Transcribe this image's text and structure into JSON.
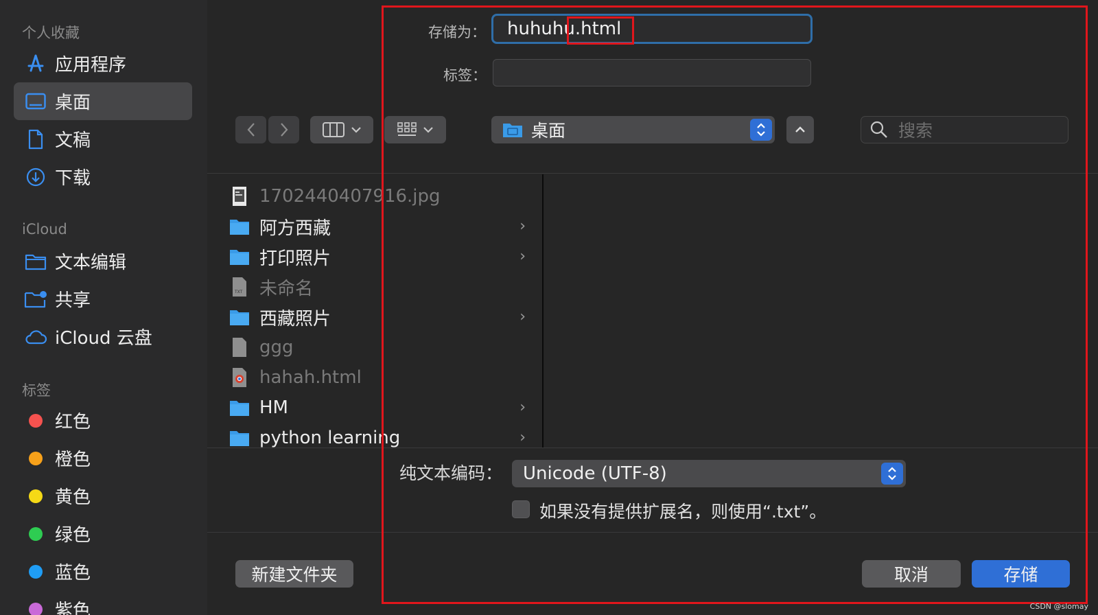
{
  "sidebar": {
    "sections": [
      {
        "title": "个人收藏"
      },
      {
        "title": "iCloud"
      },
      {
        "title": "标签"
      }
    ],
    "favorites": [
      {
        "label": "应用程序",
        "icon": "app-store-icon"
      },
      {
        "label": "桌面",
        "icon": "desktop-icon",
        "selected": true
      },
      {
        "label": "文稿",
        "icon": "document-icon"
      },
      {
        "label": "下载",
        "icon": "download-icon"
      }
    ],
    "icloud": [
      {
        "label": "文本编辑",
        "icon": "folder-icon"
      },
      {
        "label": "共享",
        "icon": "shared-folder-icon"
      },
      {
        "label": "iCloud 云盘",
        "icon": "cloud-icon"
      }
    ],
    "tags": [
      {
        "label": "红色",
        "color": "#f5524f"
      },
      {
        "label": "橙色",
        "color": "#f7a11a"
      },
      {
        "label": "黄色",
        "color": "#f5d916"
      },
      {
        "label": "绿色",
        "color": "#2ecc52"
      },
      {
        "label": "蓝色",
        "color": "#1f9df5"
      },
      {
        "label": "紫色",
        "color": "#c96ad8"
      }
    ]
  },
  "save_as": {
    "label": "存储为：",
    "value": "huhuhu.html"
  },
  "tags_field": {
    "label": "标签：",
    "value": ""
  },
  "toolbar": {
    "location": "桌面",
    "search_placeholder": "搜索"
  },
  "files": [
    {
      "name": "1702440407916.jpg",
      "type": "image",
      "dim": true,
      "has_children": false
    },
    {
      "name": "阿方西藏",
      "type": "folder",
      "dim": false,
      "has_children": true
    },
    {
      "name": "打印照片",
      "type": "folder",
      "dim": false,
      "has_children": true
    },
    {
      "name": "未命名",
      "type": "txt",
      "dim": true,
      "has_children": false
    },
    {
      "name": "西藏照片",
      "type": "folder",
      "dim": false,
      "has_children": true
    },
    {
      "name": "ggg",
      "type": "file",
      "dim": true,
      "has_children": false
    },
    {
      "name": "hahah.html",
      "type": "chrome-html",
      "dim": true,
      "has_children": false
    },
    {
      "name": "HM",
      "type": "folder",
      "dim": false,
      "has_children": true
    },
    {
      "name": "python learning",
      "type": "folder",
      "dim": false,
      "has_children": true
    }
  ],
  "encoding": {
    "label": "纯文本编码：",
    "value": "Unicode (UTF-8)"
  },
  "extension_option": {
    "label": "如果没有提供扩展名，则使用“.txt”。",
    "checked": false
  },
  "buttons": {
    "new_folder": "新建文件夹",
    "cancel": "取消",
    "save": "存储"
  },
  "watermark": "CSDN @slomay",
  "colors": {
    "accent": "#2f6fd6",
    "highlight": "#e0161c"
  }
}
